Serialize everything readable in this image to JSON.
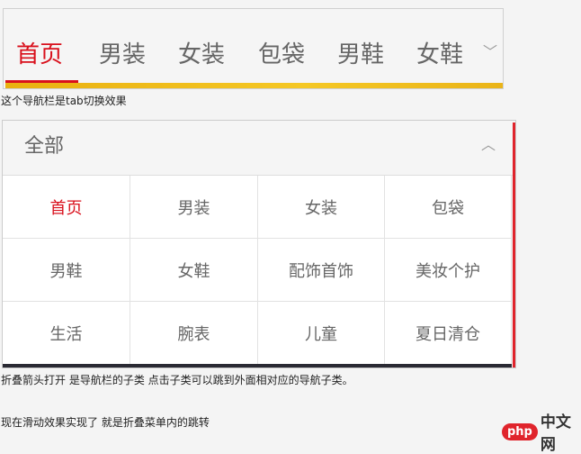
{
  "nav": {
    "tabs": [
      "首页",
      "男装",
      "女装",
      "包袋",
      "男鞋",
      "女鞋"
    ],
    "active": 0
  },
  "captions": [
    "这个导航栏是tab切换效果",
    "折叠箭头打开 是导航栏的子类  点击子类可以跳到外面相对应的导航子类。",
    "现在滑动效果实现了 就是折叠菜单内的跳转"
  ],
  "panel": {
    "title": "全部",
    "items": [
      "首页",
      "男装",
      "女装",
      "包袋",
      "男鞋",
      "女鞋",
      "配饰首饰",
      "美妆个护",
      "生活",
      "腕表",
      "儿童",
      "夏日清仓"
    ]
  },
  "logo": {
    "php": "php",
    "cn": "中文网"
  },
  "colors": {
    "accent": "#d9101c",
    "yellow": "#f0b418"
  }
}
